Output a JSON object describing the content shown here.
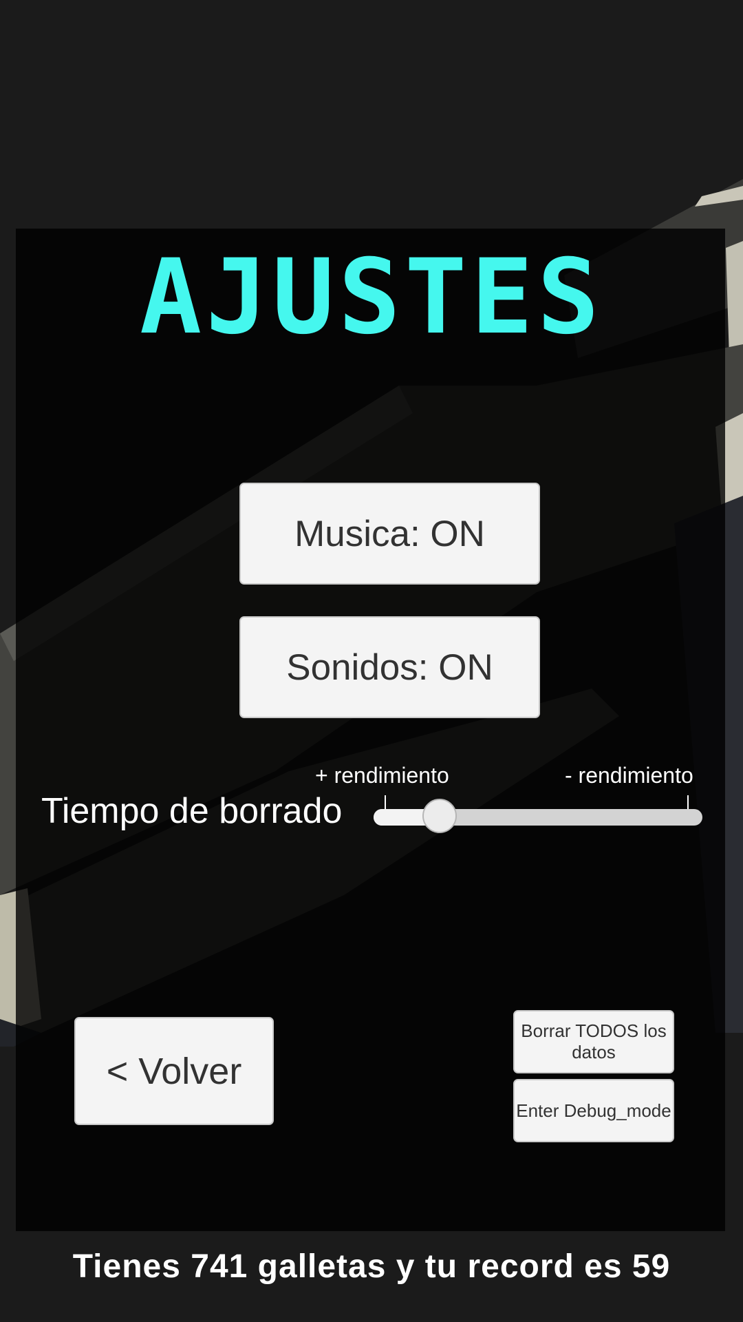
{
  "settings": {
    "title": "AJUSTES",
    "music_button": "Musica: ON",
    "sounds_button": "Sonidos: ON",
    "slider": {
      "label": "Tiempo de borrado",
      "min_hint": "+ rendimiento",
      "max_hint": "- rendimiento",
      "value_fraction": 0.2
    },
    "back_button": "< Volver",
    "delete_all_button": "Borrar TODOS los datos",
    "debug_button": "Enter Debug_mode"
  },
  "footer": {
    "status": "Tienes 741 galletas y tu record es 59"
  },
  "colors": {
    "title": "#45f7ee",
    "background": "#1b1b1b",
    "button_face": "#f4f4f4",
    "button_text": "#323232"
  }
}
